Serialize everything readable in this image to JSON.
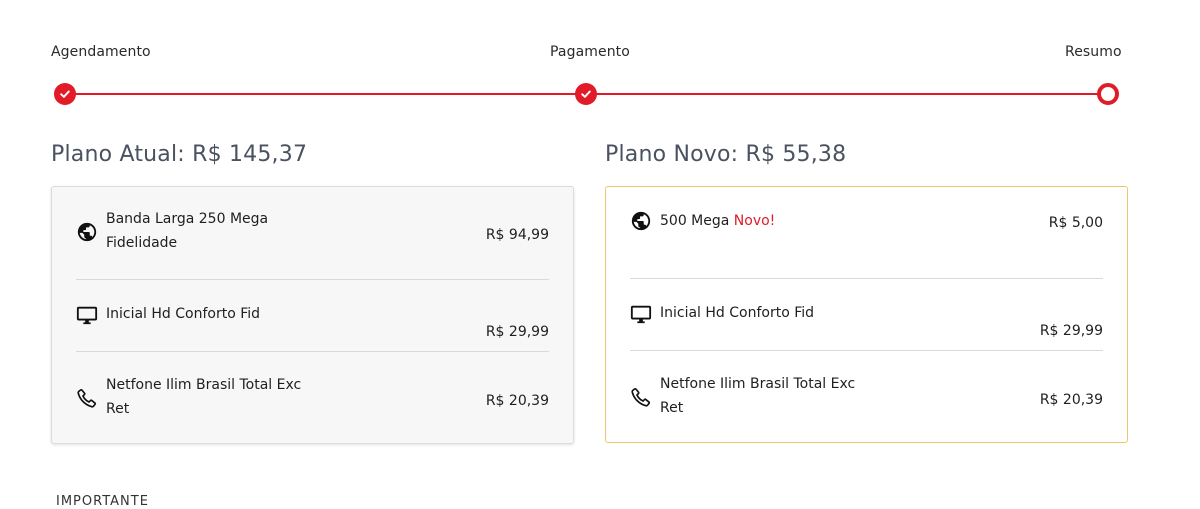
{
  "stepper": {
    "steps": [
      {
        "label": "Agendamento",
        "state": "done"
      },
      {
        "label": "Pagamento",
        "state": "done"
      },
      {
        "label": "Resumo",
        "state": "current"
      }
    ],
    "color": "#e11b28"
  },
  "current_plan": {
    "title": "Plano Atual: R$ 145,37",
    "items": [
      {
        "icon": "globe-icon",
        "name_line1": "Banda Larga 250 Mega",
        "name_line2": "Fidelidade",
        "price": "R$ 94,99"
      },
      {
        "icon": "monitor-icon",
        "name_line1": "Inicial Hd Conforto Fid",
        "name_line2": "",
        "price": "R$ 29,99"
      },
      {
        "icon": "phone-icon",
        "name_line1": "Netfone Ilim Brasil Total Exc",
        "name_line2": "Ret",
        "price": "R$ 20,39"
      }
    ]
  },
  "new_plan": {
    "title": "Plano Novo: R$ 55,38",
    "items": [
      {
        "icon": "globe-icon",
        "name_line1": "500 Mega",
        "badge": "Novo!",
        "price": "R$ 5,00"
      },
      {
        "icon": "monitor-icon",
        "name_line1": "Inicial Hd Conforto Fid",
        "name_line2": "",
        "price": "R$ 29,99"
      },
      {
        "icon": "phone-icon",
        "name_line1": "Netfone Ilim Brasil Total Exc",
        "name_line2": "Ret",
        "price": "R$ 20,39"
      }
    ],
    "highlight_border": "#f1c470",
    "badge_color": "#e11b28"
  },
  "footer": {
    "section_heading": "IMPORTANTE"
  }
}
